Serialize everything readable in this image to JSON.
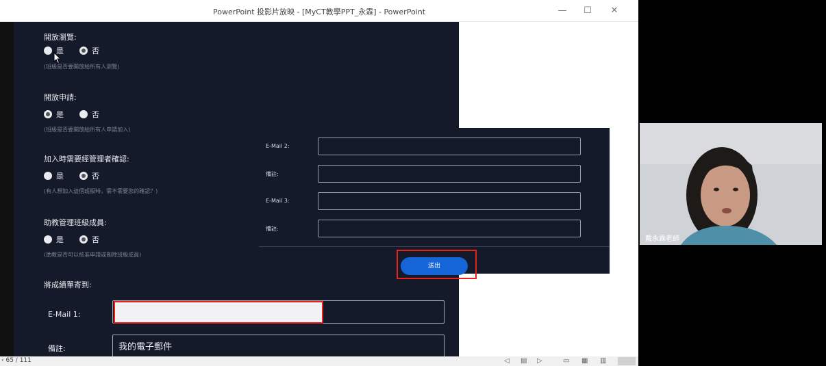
{
  "window": {
    "title": "PowerPoint 投影片放映 - [MyCT教學PPT_永霖] - PowerPoint",
    "minimize": "—",
    "maximize": "☐",
    "close": "✕"
  },
  "form": {
    "open_browse": {
      "label": "開放瀏覽:",
      "yes": "是",
      "no": "否",
      "selected": "no",
      "hint": "(班級是否要開放給所有人瀏覽)"
    },
    "open_apply": {
      "label": "開放申請:",
      "yes": "是",
      "no": "否",
      "selected": "yes",
      "hint": "(班級是否要開放給所有人申請加入)"
    },
    "admin_confirm": {
      "label": "加入時需要經管理者確認:",
      "yes": "是",
      "no": "否",
      "selected": "no",
      "hint": "(有人想加入這個班級時，需不需要您的確認？)"
    },
    "ta_manage": {
      "label": "助教管理班級成員:",
      "yes": "是",
      "no": "否",
      "selected": "no",
      "hint": "(助教是否可以核准申請或刪除班級成員)"
    },
    "send_to_label": "將成績單寄到:",
    "email1_label": "E-Mail 1:",
    "email1_value": "",
    "note1_label": "備註:",
    "note1_value": "我的電子郵件"
  },
  "right_form": {
    "email2_label": "E-Mail 2:",
    "note2_label": "備註:",
    "email3_label": "E-Mail 3:",
    "note3_label": "備註:",
    "submit_label": "送出"
  },
  "statusbar": {
    "slide_indicator": "65 / 111",
    "prefix": "‹"
  },
  "webcam": {
    "name": "戴永霖老師"
  },
  "colors": {
    "slide_bg": "#151a2a",
    "submit_blue": "#1565d8",
    "highlight_red": "#e8231c"
  }
}
